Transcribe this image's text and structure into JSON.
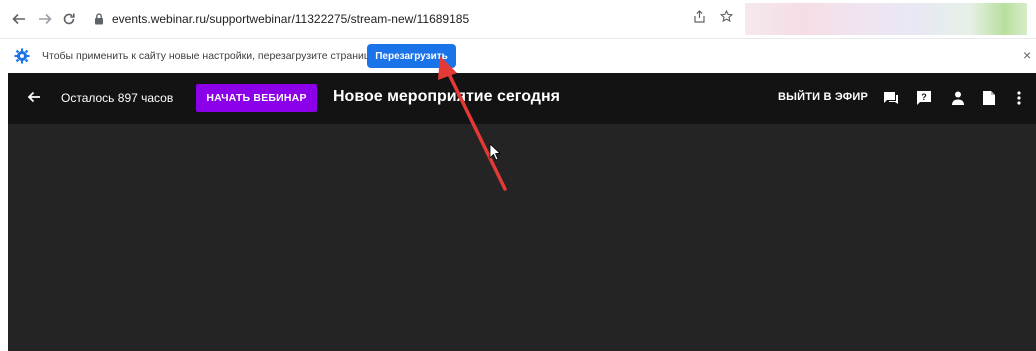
{
  "browser": {
    "url": "events.webinar.ru/supportwebinar/11322275/stream-new/11689185",
    "back_icon": "back-arrow-icon",
    "forward_icon": "forward-arrow-icon",
    "reload_icon": "reload-icon",
    "lock_icon": "lock-icon",
    "share_icon": "share-icon",
    "bookmark_icon": "star-icon"
  },
  "infobar": {
    "message": "Чтобы применить к сайту новые настройки, перезагрузите страницу",
    "reload_label": "Перезагрузить",
    "close_label": "×",
    "accent": "#1a73e8"
  },
  "webinar": {
    "remaining": "Осталось 897 часов",
    "start_label": "НАЧАТЬ ВЕБИНАР",
    "title": "Новое мероприятие сегодня",
    "onair_label": "ВЫЙТИ В ЭФИР",
    "start_color": "#8b00e8",
    "icons": [
      "chat-icon",
      "question-icon",
      "person-icon",
      "document-icon",
      "more-vertical-icon"
    ]
  },
  "annotation": {
    "arrow_color": "#e53935"
  }
}
